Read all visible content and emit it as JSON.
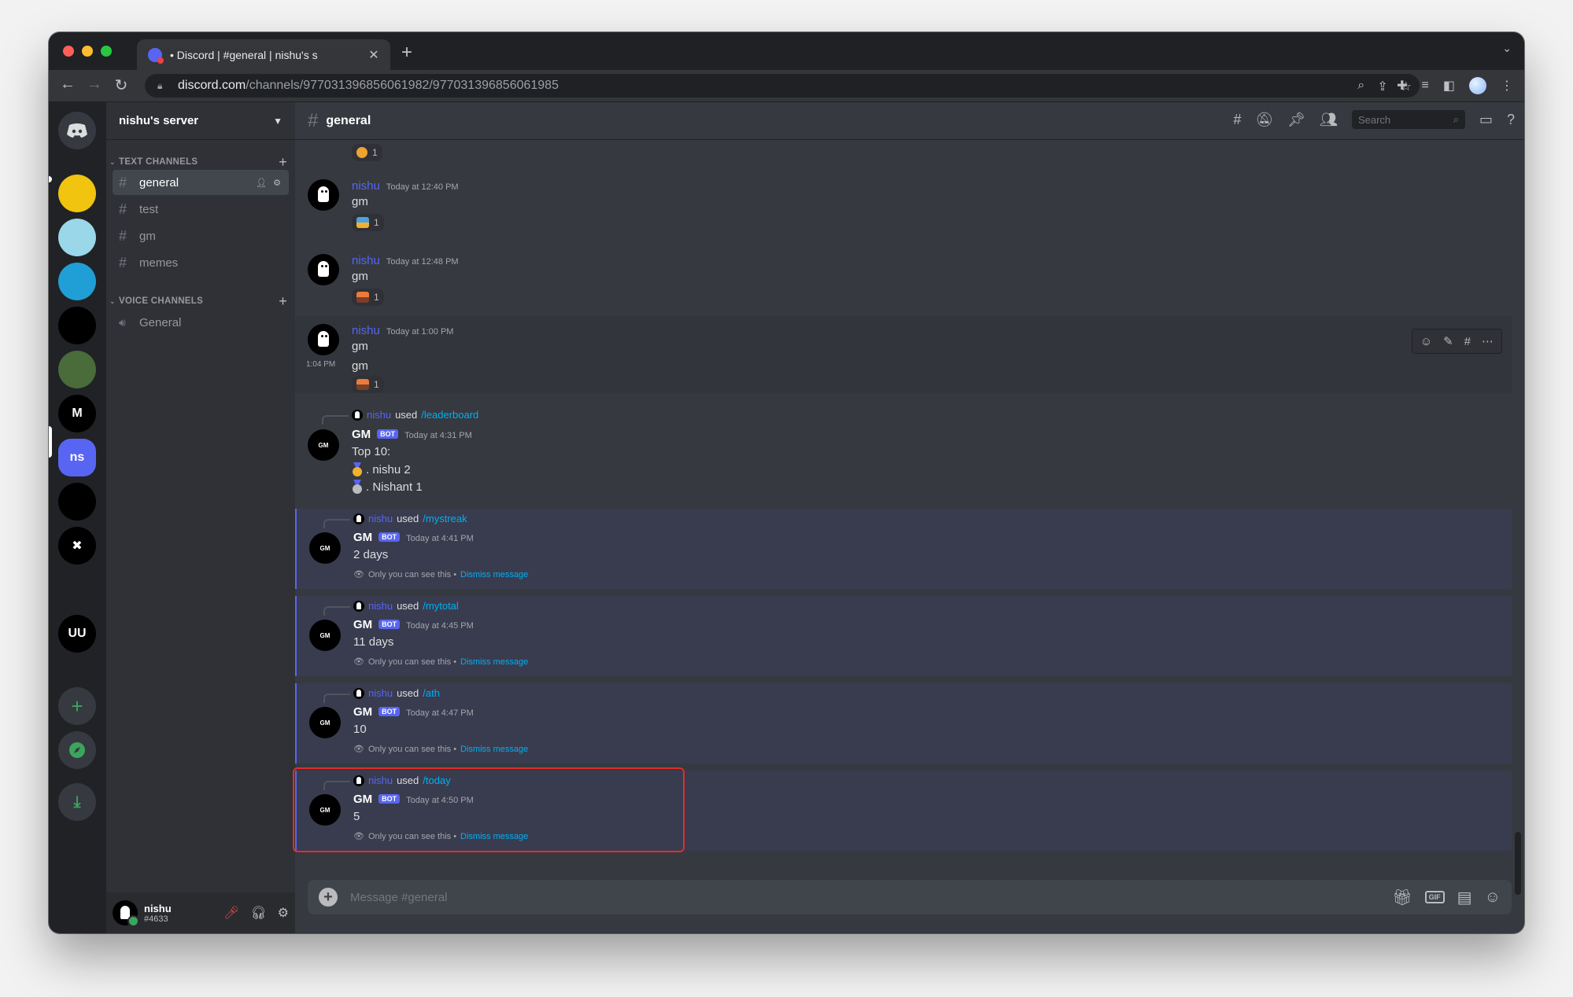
{
  "browser": {
    "tab_title": "• Discord | #general | nishu's s",
    "url_host": "discord.com",
    "url_path": "/channels/977031396856061982/977031396856061985"
  },
  "server": {
    "name": "nishu's server",
    "categories": {
      "text": "TEXT CHANNELS",
      "voice": "VOICE CHANNELS"
    },
    "text_channels": [
      "general",
      "test",
      "gm",
      "memes"
    ],
    "voice_channels": [
      "General"
    ],
    "guild_icons": [
      {
        "label": "",
        "color": "#f1c40f"
      },
      {
        "label": "",
        "color": "#9ad7e8"
      },
      {
        "label": "",
        "color": "#1f9fd6"
      },
      {
        "label": "",
        "color": "#000000"
      },
      {
        "label": "",
        "color": "#4a6b3a"
      },
      {
        "label": "M",
        "color": "#000000"
      },
      {
        "label": "ns",
        "color": "#5865f2"
      },
      {
        "label": "",
        "color": "#000000"
      },
      {
        "label": "✖",
        "color": "#000000"
      },
      {
        "label": "",
        "color": "#202225"
      },
      {
        "label": "UU",
        "color": "#000000"
      }
    ]
  },
  "user": {
    "name": "nishu",
    "tag": "#4633"
  },
  "channel": {
    "name": "general",
    "search_placeholder": "Search",
    "composer_placeholder": "Message #general"
  },
  "messages": [
    {
      "author": "nishu",
      "time": "Today at 12:40 PM",
      "text": "gm",
      "reaction_count": "1"
    },
    {
      "author": "nishu",
      "time": "Today at 12:48 PM",
      "text": "gm",
      "reaction_count": "1"
    },
    {
      "author": "nishu",
      "time": "Today at 1:00 PM",
      "text": "gm",
      "text2": "gm",
      "side_time": "1:04 PM",
      "reaction_count": "1"
    }
  ],
  "top_reaction_count": "1",
  "bot_messages": [
    {
      "invoker": "nishu",
      "used": "used",
      "command": "/leaderboard",
      "bot": "GM",
      "badge": "BOT",
      "time": "Today at 4:31 PM",
      "text": "Top 10:",
      "rows": [
        ". nishu 2",
        ". Nishant 1"
      ]
    },
    {
      "invoker": "nishu",
      "used": "used",
      "command": "/mystreak",
      "bot": "GM",
      "badge": "BOT",
      "time": "Today at 4:41 PM",
      "text": "2 days",
      "note": "Only you can see this •",
      "dismiss": "Dismiss message"
    },
    {
      "invoker": "nishu",
      "used": "used",
      "command": "/mytotal",
      "bot": "GM",
      "badge": "BOT",
      "time": "Today at 4:45 PM",
      "text": "11 days",
      "note": "Only you can see this •",
      "dismiss": "Dismiss message"
    },
    {
      "invoker": "nishu",
      "used": "used",
      "command": "/ath",
      "bot": "GM",
      "badge": "BOT",
      "time": "Today at 4:47 PM",
      "text": "10",
      "note": "Only you can see this •",
      "dismiss": "Dismiss message"
    },
    {
      "invoker": "nishu",
      "used": "used",
      "command": "/today",
      "bot": "GM",
      "badge": "BOT",
      "time": "Today at 4:50 PM",
      "text": "5",
      "note": "Only you can see this •",
      "dismiss": "Dismiss message"
    }
  ],
  "bot_avatar_label": "GM",
  "colors": {
    "blurple": "#5865f2",
    "link": "#00aff4",
    "highlight": "#e32c2c"
  }
}
